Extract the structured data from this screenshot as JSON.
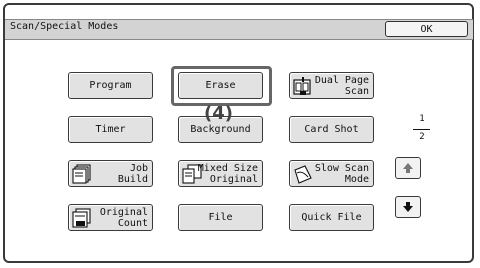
{
  "header": {
    "title": "Scan/Special Modes",
    "ok_label": "OK"
  },
  "buttons": {
    "program": "Program",
    "erase": "Erase",
    "dual_page_scan": "Dual Page\nScan",
    "timer": "Timer",
    "background": "Background",
    "card_shot": "Card Shot",
    "job_build": "Job\nBuild",
    "mixed_size_original": "Mixed Size\nOriginal",
    "slow_scan_mode": "Slow Scan\nMode",
    "original_count": "Original\nCount",
    "file": "File",
    "quick_file": "Quick File"
  },
  "pagination": {
    "current": "1",
    "total": "2"
  },
  "callout": {
    "label": "(4)"
  },
  "icons": [
    "dual-page-scan-icon",
    "job-build-icon",
    "mixed-size-original-icon",
    "slow-scan-mode-icon",
    "original-count-icon",
    "up-arrow-icon",
    "down-arrow-icon"
  ]
}
